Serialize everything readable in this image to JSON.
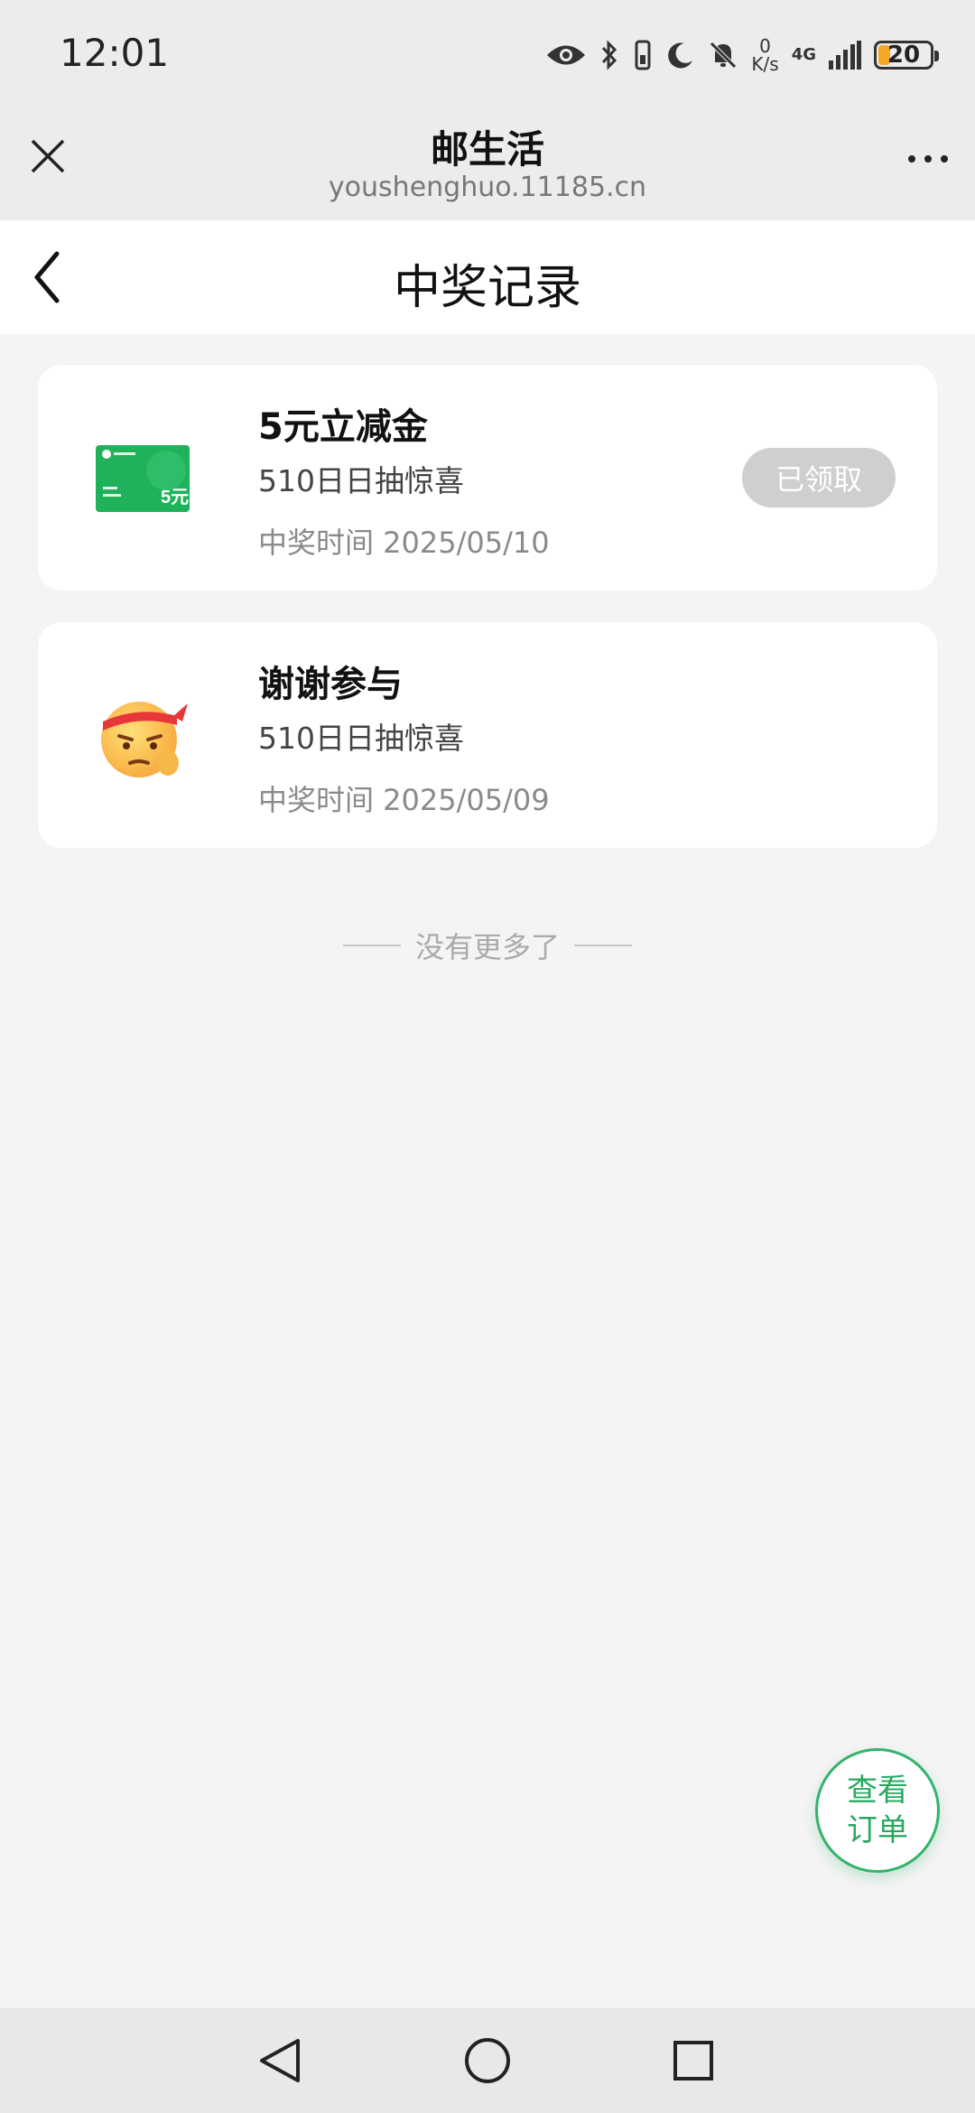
{
  "status_bar": {
    "time": "12:01",
    "network_speed_value": "0",
    "network_speed_unit": "K/s",
    "network_type": "4G",
    "battery_level": "20",
    "battery_fraction": 0.2,
    "icons": [
      "eye-icon",
      "bluetooth-icon",
      "vibrate-icon",
      "moon-icon",
      "bell-off-icon",
      "signal-icon",
      "battery-icon"
    ]
  },
  "web_header": {
    "title": "邮生活",
    "url": "youshenghuo.11185.cn"
  },
  "page": {
    "title": "中奖记录"
  },
  "records": [
    {
      "title": "5元立减金",
      "activity": "510日日抽惊喜",
      "time": "中奖时间 2025/05/10",
      "status": "已领取",
      "icon": "voucher-card-icon",
      "voucher_amount": "5元"
    },
    {
      "title": "谢谢参与",
      "activity": "510日日抽惊喜",
      "time": "中奖时间 2025/05/09",
      "icon": "emoji-face-icon"
    }
  ],
  "footer_text": "没有更多了",
  "order_button": {
    "line1": "查看",
    "line2": "订单"
  },
  "colors": {
    "accent_green": "#2aa860",
    "voucher_green": "#1fb25a",
    "claimed_gray": "#cfcfcf",
    "background": "#f4f4f4"
  }
}
